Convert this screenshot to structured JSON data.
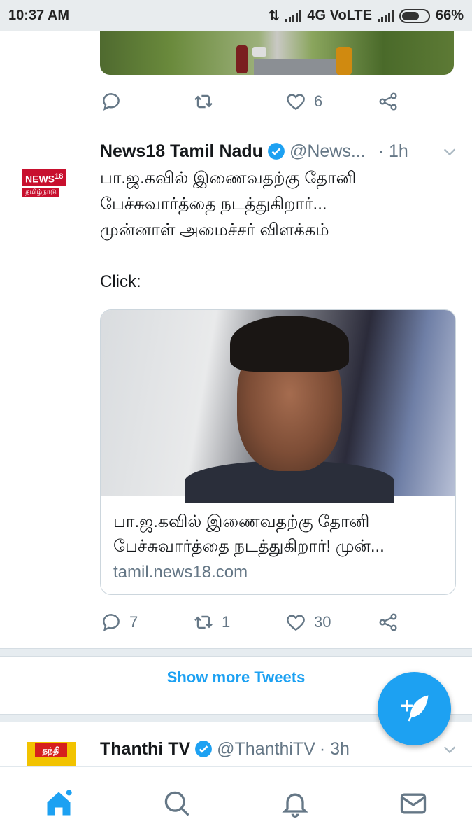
{
  "status_bar": {
    "time": "10:37 AM",
    "network": "4G VoLTE",
    "battery": "66%",
    "battery_level": 0.66
  },
  "top_tweet_actions": {
    "reply_count": "",
    "retweet_count": "",
    "like_count": "6"
  },
  "tweet": {
    "name": "News18 Tamil Nadu",
    "handle": "@News...",
    "time": "· 1h",
    "text_line1": "பா.ஜ.கவில் இணைவதற்கு தோனி",
    "text_line2": "பேச்சுவார்த்தை நடத்துகிறார்...",
    "text_line3": "முன்னாள் அமைச்சர் விளக்கம்",
    "click_text": "Click:",
    "avatar_top": "NEWS18",
    "avatar_bottom": "தமிழ்நாடு",
    "card": {
      "title_line1": "பா.ஜ.கவில் இணைவதற்கு தோனி",
      "title_line2": "பேச்சுவார்த்தை நடத்துகிறார்! முன்...",
      "domain": "tamil.news18.com"
    },
    "reply_count": "7",
    "retweet_count": "1",
    "like_count": "30"
  },
  "show_more": "Show more Tweets",
  "next_tweet": {
    "name": "Thanthi TV",
    "handle": "@ThanthiTV",
    "time": "· 3h",
    "avatar_text": "தந்தி"
  },
  "icons": {
    "reply": "reply-icon",
    "retweet": "retweet-icon",
    "like": "heart-icon",
    "share": "share-icon",
    "verified": "verified-badge-icon",
    "compose": "compose-tweet-icon",
    "home": "home-icon",
    "search": "search-icon",
    "notifications": "bell-icon",
    "messages": "mail-icon"
  },
  "colors": {
    "accent": "#1da1f2",
    "muted": "#657786",
    "text": "#14171a"
  }
}
